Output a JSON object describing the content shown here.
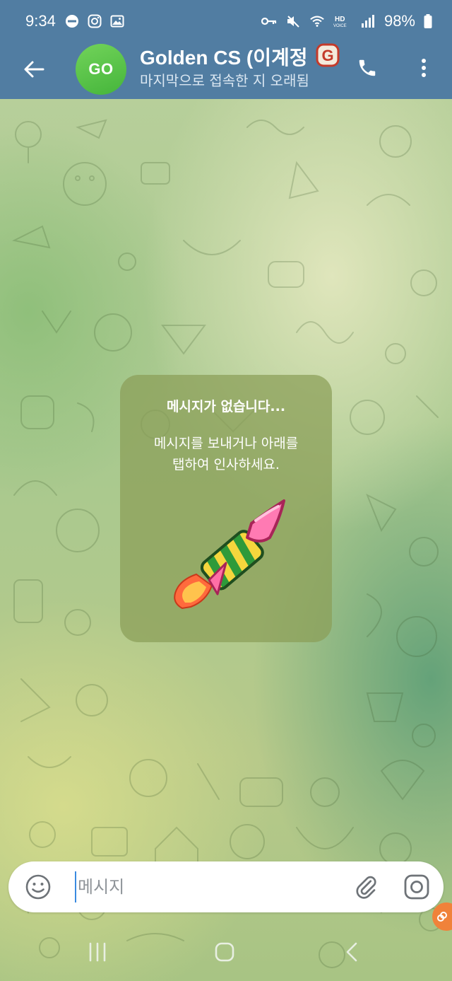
{
  "status_bar": {
    "time": "9:34",
    "battery": "98%",
    "icons_left": [
      "dnd-icon",
      "instagram-icon",
      "gallery-icon"
    ],
    "icons_right": [
      "key-icon",
      "mute-icon",
      "wifi-icon",
      "hd-voice-icon",
      "signal-icon",
      "battery-icon"
    ]
  },
  "header": {
    "avatar_initials": "GO",
    "title": "Golden CS (이계정",
    "subtitle": "마지막으로 접속한 지 오래됨",
    "accent": "#517da2",
    "avatar_color": "#4fbf43"
  },
  "empty_state": {
    "title": "메시지가 없습니다...",
    "description_line1": "메시지를 보내거나 아래를",
    "description_line2": "탭하여 인사하세요.",
    "sticker": "rocket-sticker"
  },
  "composer": {
    "placeholder": "메시지",
    "value": ""
  },
  "navbar": {
    "buttons": [
      "recents-icon",
      "home-icon",
      "back-icon"
    ]
  }
}
